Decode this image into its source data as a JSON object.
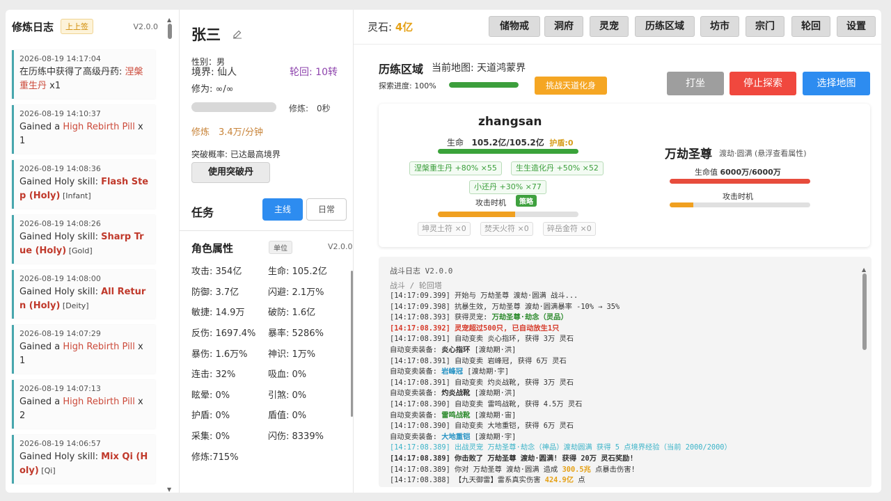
{
  "log_panel": {
    "title": "修炼日志",
    "tag": "上上签",
    "version": "V2.0.0",
    "items": [
      {
        "time": "2026-08-19 14:17:04",
        "prefix": "在历练中获得了高级丹药: ",
        "highlight": "涅槃重生丹",
        "suffix": " x1",
        "hl_bold": false
      },
      {
        "time": "2026-08-19 14:10:37",
        "prefix": "Gained a ",
        "highlight": "High Rebirth Pill",
        "suffix": " x 1",
        "hl_bold": false
      },
      {
        "time": "2026-08-19 14:08:36",
        "prefix": "Gained Holy skill: ",
        "highlight": "Flash Step (Holy)",
        "suffix": " [Infant]",
        "hl_bold": true
      },
      {
        "time": "2026-08-19 14:08:26",
        "prefix": "Gained Holy skill: ",
        "highlight": "Sharp True (Holy)",
        "suffix": " [Gold]",
        "hl_bold": true
      },
      {
        "time": "2026-08-19 14:08:00",
        "prefix": "Gained Holy skill: ",
        "highlight": "All Return (Holy)",
        "suffix": " [Deity]",
        "hl_bold": true
      },
      {
        "time": "2026-08-19 14:07:29",
        "prefix": "Gained a ",
        "highlight": "High Rebirth Pill",
        "suffix": " x 1",
        "hl_bold": false
      },
      {
        "time": "2026-08-19 14:07:13",
        "prefix": "Gained a ",
        "highlight": "High Rebirth Pill",
        "suffix": " x 2",
        "hl_bold": false
      },
      {
        "time": "2026-08-19 14:06:57",
        "prefix": "Gained Holy skill: ",
        "highlight": "Mix Qi (Holy)",
        "suffix": " [Qi]",
        "hl_bold": true
      }
    ]
  },
  "character": {
    "name": "张三",
    "gender": "性别：男",
    "realm": "境界: 仙人",
    "rebirth": "轮回: 10转",
    "cultivation": "修为: ∞/∞",
    "cult_label": "修炼:　0秒",
    "rate": "修炼　3.4万/分钟",
    "break_rate": "突破概率: 已达最高境界",
    "break_button": "使用突破丹",
    "task_title": "任务",
    "tab_main": "主线",
    "tab_daily": "日常",
    "attr_title": "角色属性",
    "attr_unit": "单位",
    "attr_version": "V2.0.0",
    "attributes": [
      [
        "攻击: 354亿",
        "生命: 105.2亿"
      ],
      [
        "防御: 3.7亿",
        "闪避: 2.1万%"
      ],
      [
        "敏捷: 14.9万",
        "破防: 1.6亿"
      ],
      [
        "反伤: 1697.4%",
        "暴率: 5286%"
      ],
      [
        "暴伤: 1.6万%",
        "神识: 1万%"
      ],
      [
        "连击: 32%",
        "吸血: 0%"
      ],
      [
        "眩晕: 0%",
        "引煞: 0%"
      ],
      [
        "护盾: 0%",
        "盾值: 0%"
      ],
      [
        "采集: 0%",
        "闪伤: 8339%"
      ],
      [
        "修炼:715%",
        ""
      ]
    ]
  },
  "topbar": {
    "stone_label": "灵石: ",
    "stone_value": "4亿",
    "nav": [
      "储物戒",
      "洞府",
      "灵宠",
      "历练区域",
      "坊市",
      "宗门",
      "轮回",
      "设置"
    ]
  },
  "area": {
    "title": "历练区域",
    "map": "当前地图: 天道鸿蒙界",
    "progress_label": "探索进度: 100%",
    "progress": 1.0,
    "challenge": "挑战天道化身",
    "btn_meditate": "打坐",
    "btn_stop": "停止探索",
    "btn_select": "选择地图"
  },
  "battle": {
    "player_name": "zhangsan",
    "hp_label": "生命",
    "hp_value": "105.2亿/105.2亿",
    "shield": "护盾:0",
    "buffs": [
      "涅槃重生丹 +80% ×55",
      "生生造化丹 +50% ×52",
      "小还丹 +30% ×77"
    ],
    "attack_timing": "攻击时机",
    "strategy": "策略",
    "player_attack_fill": 0.55,
    "talismans": [
      "坤灵土符 ×0",
      "焚天火符 ×0",
      "碎岳金符 ×0"
    ],
    "enemy_name": "万劫圣尊",
    "enemy_sub": "渡劫·圆满 (悬浮查看属性)",
    "enemy_hp_label": "生命值 ",
    "enemy_hp_value": "6000万/6000万",
    "enemy_attack_timing": "攻击时机",
    "enemy_attack_fill": 0.17
  },
  "battle_log": {
    "header": "战斗日志 V2.0.0",
    "path": "战斗 / 轮回塔",
    "lines": [
      {
        "style": "",
        "parts": [
          {
            "t": "[14:17:09.399] 开始与 万劫圣尊 渡劫·圆满 战斗...",
            "c": ""
          }
        ]
      },
      {
        "style": "",
        "parts": [
          {
            "t": "[14:17:09.398] 抗暴生效, 万劫圣尊 渡劫·圆满暴率 -10% → 35%",
            "c": ""
          }
        ]
      },
      {
        "style": "",
        "parts": [
          {
            "t": "[14:17:08.393] 获得灵宠: ",
            "c": ""
          },
          {
            "t": "万劫圣尊·劫念（灵品）",
            "c": "g"
          }
        ]
      },
      {
        "style": "red",
        "parts": [
          {
            "t": "[14:17:08.392] 灵宠超过500只, 已自动放生1只",
            "c": ""
          }
        ]
      },
      {
        "style": "",
        "parts": [
          {
            "t": "[14:17:08.391] 自动变卖 炎心指环, 获得 3万 灵石",
            "c": ""
          }
        ]
      },
      {
        "style": "",
        "parts": [
          {
            "t": "自动变卖装备: ",
            "c": ""
          },
          {
            "t": "炎心指环",
            "c": "b"
          },
          {
            "t": " [渡劫期·洪]",
            "c": ""
          }
        ]
      },
      {
        "style": "",
        "parts": [
          {
            "t": "[14:17:08.391] 自动变卖 岩峰冠, 获得 6万 灵石",
            "c": ""
          }
        ]
      },
      {
        "style": "",
        "parts": [
          {
            "t": "自动变卖装备: ",
            "c": ""
          },
          {
            "t": "岩峰冠",
            "c": "c"
          },
          {
            "t": " [渡劫期·宇]",
            "c": ""
          }
        ]
      },
      {
        "style": "",
        "parts": [
          {
            "t": "[14:17:08.391] 自动变卖 灼炎战靴, 获得 3万 灵石",
            "c": ""
          }
        ]
      },
      {
        "style": "",
        "parts": [
          {
            "t": "自动变卖装备: ",
            "c": ""
          },
          {
            "t": "灼炎战靴",
            "c": "b"
          },
          {
            "t": " [渡劫期·洪]",
            "c": ""
          }
        ]
      },
      {
        "style": "",
        "parts": [
          {
            "t": "[14:17:08.390] 自动变卖 雷鸣战靴, 获得 4.5万 灵石",
            "c": ""
          }
        ]
      },
      {
        "style": "",
        "parts": [
          {
            "t": "自动变卖装备: ",
            "c": ""
          },
          {
            "t": "雷鸣战靴",
            "c": "g"
          },
          {
            "t": " [渡劫期·宙]",
            "c": ""
          }
        ]
      },
      {
        "style": "",
        "parts": [
          {
            "t": "[14:17:08.390] 自动变卖 大地重铠, 获得 6万 灵石",
            "c": ""
          }
        ]
      },
      {
        "style": "",
        "parts": [
          {
            "t": "自动变卖装备: ",
            "c": ""
          },
          {
            "t": "大地重铠",
            "c": "c"
          },
          {
            "t": " [渡劫期·宇]",
            "c": ""
          }
        ]
      },
      {
        "style": "cyan",
        "parts": [
          {
            "t": "[14:17:08.389] 出战灵宠 万劫圣尊·劫念（神品）渡劫圆满 获得 5 点境界经验（当前 2000/2000）",
            "c": ""
          }
        ]
      },
      {
        "style": "bold",
        "parts": [
          {
            "t": "[14:17:08.389] 你击败了 万劫圣尊 渡劫·圆满! 获得 20万 灵石奖励!",
            "c": ""
          }
        ]
      },
      {
        "style": "",
        "parts": [
          {
            "t": "[14:17:08.389] 你对 万劫圣尊 渡劫·圆满 造成 ",
            "c": ""
          },
          {
            "t": "300.5兆",
            "c": "y"
          },
          {
            "t": " 点暴击伤害!",
            "c": ""
          }
        ]
      },
      {
        "style": "",
        "parts": [
          {
            "t": "[14:17:08.388] 【九天御雷】雷系真实伤害 ",
            "c": ""
          },
          {
            "t": "424.9亿",
            "c": "y"
          },
          {
            "t": " 点",
            "c": ""
          }
        ]
      }
    ]
  },
  "colors": {
    "accent_blue": "#2d8cf0",
    "stop_red": "#f0483e",
    "select_blue": "#2d8cf0",
    "meditate_gray": "#9e9e9e",
    "stone_gold": "#e5a116",
    "log_border": "#47a6ad"
  }
}
